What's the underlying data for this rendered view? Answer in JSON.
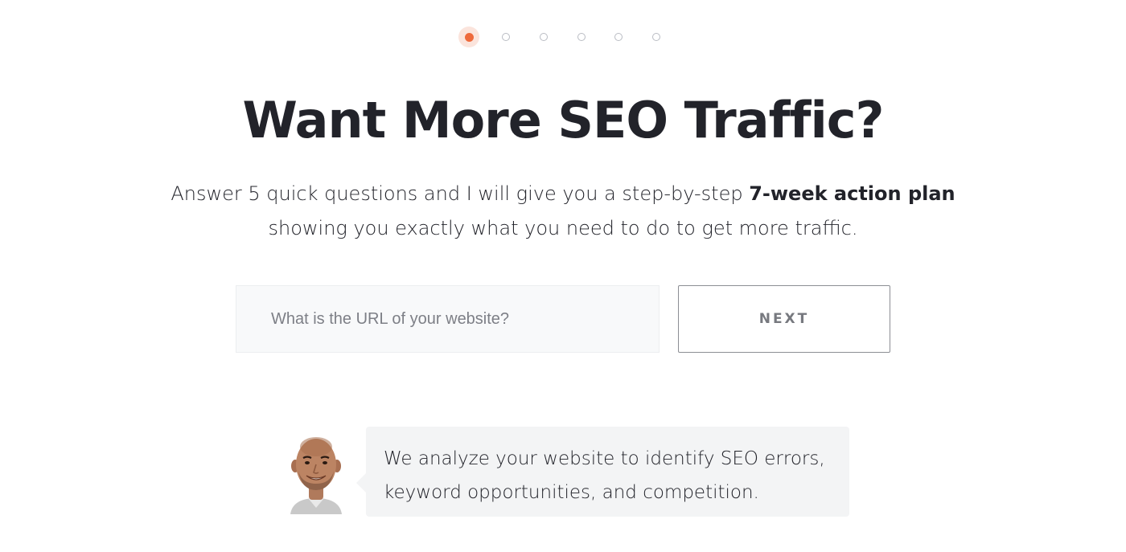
{
  "progress": {
    "total_steps": 6,
    "current_step": 1,
    "active_color": "#ee6a3c"
  },
  "hero": {
    "title": "Want More SEO Traffic?",
    "subtitle_part1": "Answer 5 quick questions and I will give you a step-by-step ",
    "subtitle_bold": "7-week action plan",
    "subtitle_part2": "showing you exactly what you need to do to get more traffic."
  },
  "form": {
    "url_value": "",
    "url_placeholder": "What is the URL of your website?",
    "next_label": "NEXT"
  },
  "info": {
    "avatar_icon": "person-avatar",
    "line1": "We analyze your website to identify SEO errors,",
    "line2": "keyword opportunities, and competition."
  },
  "colors": {
    "text": "#22232a",
    "accent": "#ee6a3c",
    "bubble_bg": "#f3f4f5",
    "input_bg": "#f8f9fa"
  }
}
